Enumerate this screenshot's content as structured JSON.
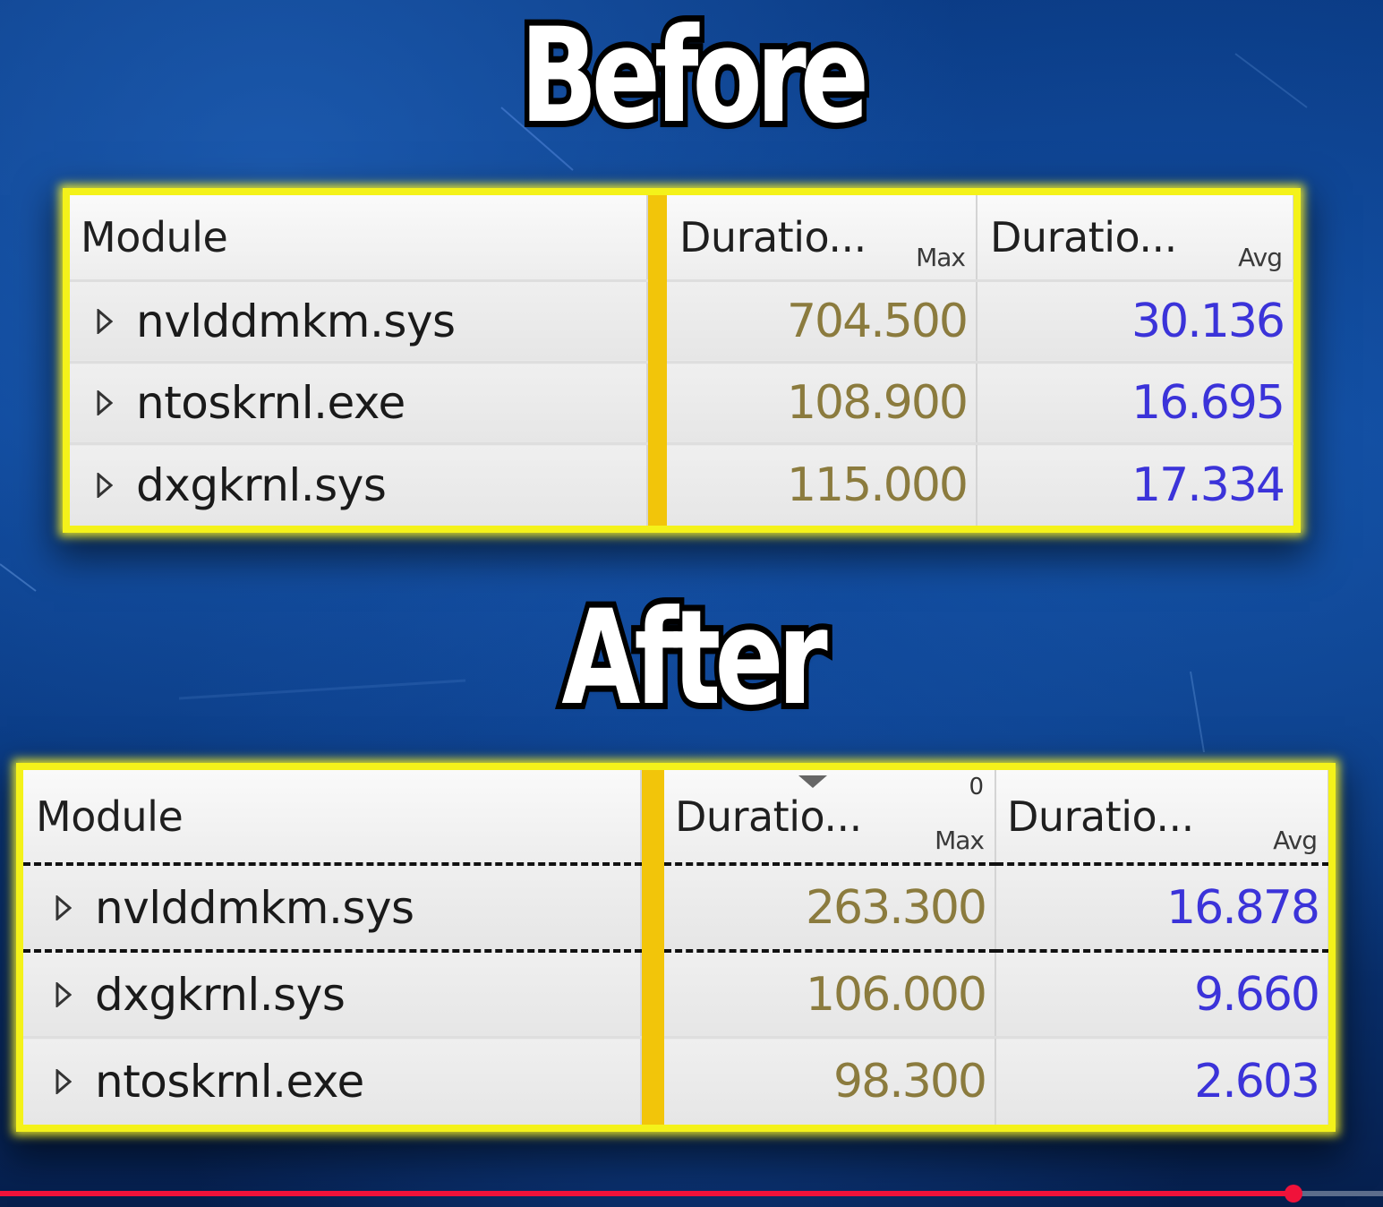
{
  "before": {
    "heading": "Before",
    "columns": {
      "module": "Module",
      "max_label": "Duratio...",
      "max_sub": "Max",
      "avg_label": "Duratio...",
      "avg_sub": "Avg"
    },
    "rows": [
      {
        "module": "nvlddmkm.sys",
        "max": "704.500",
        "avg": "30.136"
      },
      {
        "module": "ntoskrnl.exe",
        "max": "108.900",
        "avg": "16.695"
      },
      {
        "module": "dxgkrnl.sys",
        "max": "115.000",
        "avg": "17.334"
      }
    ]
  },
  "after": {
    "heading": "After",
    "columns": {
      "module": "Module",
      "max_label": "Duratio...",
      "max_sub": "Max",
      "max_marker": "0",
      "avg_label": "Duratio...",
      "avg_sub": "Avg"
    },
    "rows": [
      {
        "module": "nvlddmkm.sys",
        "max": "263.300",
        "avg": "16.878"
      },
      {
        "module": "dxgkrnl.sys",
        "max": "106.000",
        "avg": "9.660"
      },
      {
        "module": "ntoskrnl.exe",
        "max": "98.300",
        "avg": "2.603"
      }
    ]
  },
  "video_progress": 0.935,
  "colors": {
    "highlight": "#f4f21a",
    "separator": "#f2c50a",
    "max_value": "#8b7b3e",
    "avg_value": "#3b33d9",
    "progress": "#f0123a"
  }
}
